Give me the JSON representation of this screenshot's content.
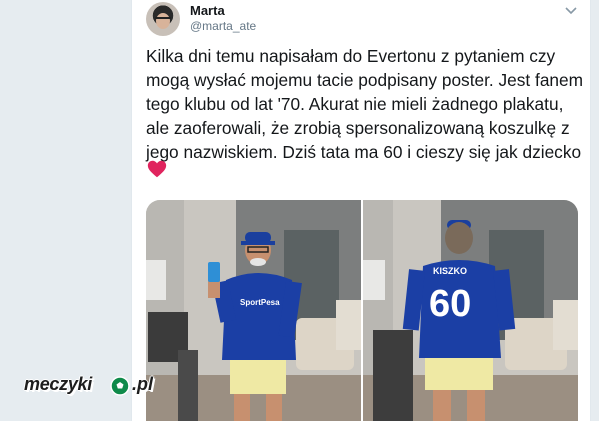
{
  "author": {
    "name": "Marta",
    "handle": "@marta_ate",
    "avatar_icon": "profile-avatar"
  },
  "tweet": {
    "text": "Kilka dni temu napisałam do Evertonu z pytaniem czy mogą wysłać mojemu tacie podpisany poster. Jest fanem tego klubu od lat '70. Akurat nie mieli żadnego plakatu, ale zaoferowali, że zrobią spersonalizowaną koszulkę z jego nazwiskiem. Dziś tata ma 60 i cieszy się jak dziecko",
    "emoji": "red-heart-icon"
  },
  "photos": [
    {
      "shirt_sponsor": "SportPesa"
    },
    {
      "shirt_name": "KISZKO",
      "shirt_number": "60"
    }
  ],
  "watermark": {
    "text": "meczyki",
    "suffix": ".pl",
    "icon": "football-icon"
  },
  "colors": {
    "everton_blue": "#1b3fa5",
    "shorts_yellow": "#efe9a4",
    "heart_red": "#e0245e",
    "watermark_green": "#0f8a4a"
  },
  "menu_icon": "chevron-down-icon"
}
